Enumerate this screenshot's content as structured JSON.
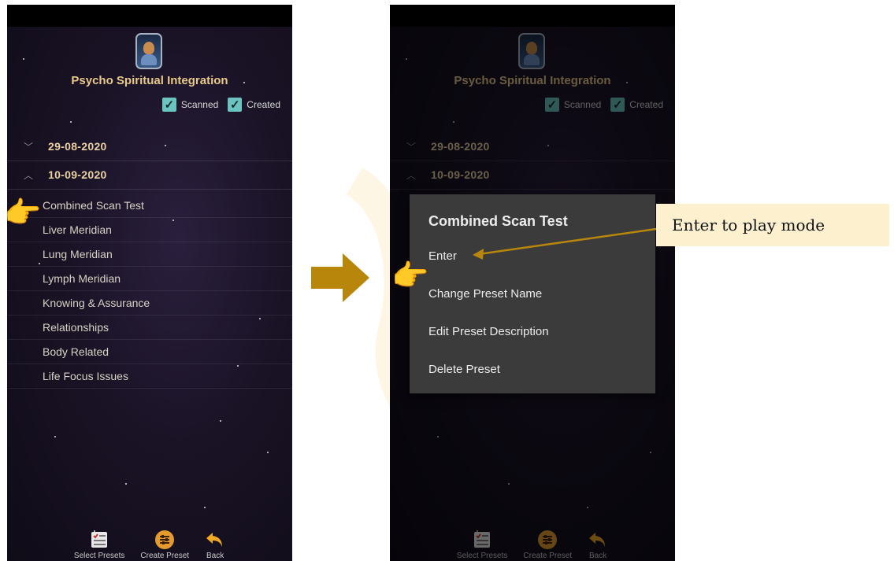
{
  "app": {
    "title": "Psycho Spiritual Integration"
  },
  "filters": {
    "scanned_label": "Scanned",
    "created_label": "Created",
    "scanned_checked": true,
    "created_checked": true
  },
  "date_groups": [
    {
      "date": "29-08-2020",
      "expanded": false
    },
    {
      "date": "10-09-2020",
      "expanded": true
    }
  ],
  "presets": [
    "Combined Scan Test",
    "Liver Meridian",
    "Lung Meridian",
    "Lymph Meridian",
    "Knowing & Assurance",
    "Relationships",
    "Body Related",
    "Life Focus Issues"
  ],
  "bottom_nav": {
    "select_presets": "Select Presets",
    "create_preset": "Create Preset",
    "back": "Back"
  },
  "context_menu": {
    "title": "Combined Scan Test",
    "items": [
      "Enter",
      "Change Preset Name",
      "Edit Preset Description",
      "Delete Preset"
    ]
  },
  "annotation": {
    "callout_text": "Enter to play mode"
  },
  "colors": {
    "accent_gold": "#b8860b",
    "title_gold": "#e8c98a",
    "checkbox_teal": "#6cc4c0",
    "callout_bg": "#fcf0cf",
    "dialog_bg": "#3b3b3b"
  }
}
